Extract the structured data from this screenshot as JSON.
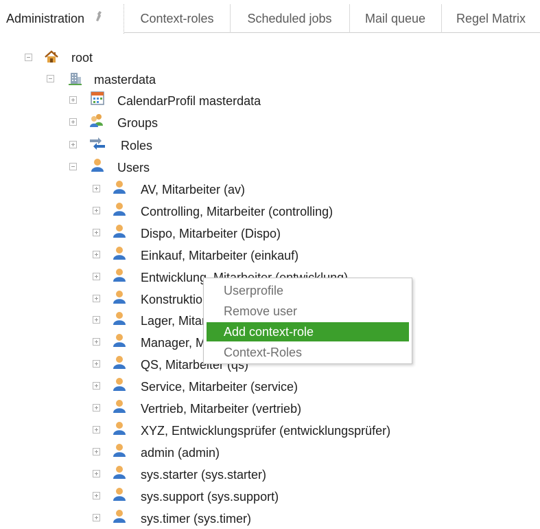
{
  "tabs": [
    {
      "label": "Administration"
    },
    {
      "label": "Context-roles"
    },
    {
      "label": "Scheduled jobs"
    },
    {
      "label": "Mail queue"
    },
    {
      "label": "Regel Matrix"
    }
  ],
  "tree": {
    "root": {
      "label": "root"
    },
    "masterdata": {
      "label": "masterdata"
    },
    "calendar": {
      "label": "CalendarProfil masterdata"
    },
    "groups": {
      "label": "Groups"
    },
    "roles": {
      "label": "Roles"
    },
    "users": {
      "label": "Users"
    },
    "user_list": [
      "AV, Mitarbeiter (av)",
      "Controlling, Mitarbeiter (controlling)",
      "Dispo, Mitarbeiter (Dispo)",
      "Einkauf, Mitarbeiter (einkauf)",
      "Entwicklung, Mitarbeiter (entwicklung)",
      "Konstruktion, Mitarbeiter (konstruktion)",
      "Lager, Mitarbeiter (lager)",
      "Manager, Mitarbeiter (manager)",
      "QS, Mitarbeiter (qs)",
      "Service, Mitarbeiter (service)",
      "Vertrieb, Mitarbeiter (vertrieb)",
      "XYZ, Entwicklungsprüfer (entwicklungsprüfer)",
      "admin (admin)",
      "sys.starter (sys.starter)",
      "sys.support (sys.support)",
      "sys.timer (sys.timer)"
    ]
  },
  "context_menu": {
    "items": [
      "Userprofile",
      "Remove user",
      "Add context-role",
      "Context-Roles"
    ],
    "highlighted": "Add context-role",
    "highlight_color": "#3c9f2c"
  },
  "icons": {
    "tab_action": "wrench-icon",
    "root": "home-icon",
    "masterdata": "building-icon",
    "calendar": "calendar-icon",
    "groups": "group-icon",
    "roles": "roles-arrows-icon",
    "user": "user-icon"
  }
}
